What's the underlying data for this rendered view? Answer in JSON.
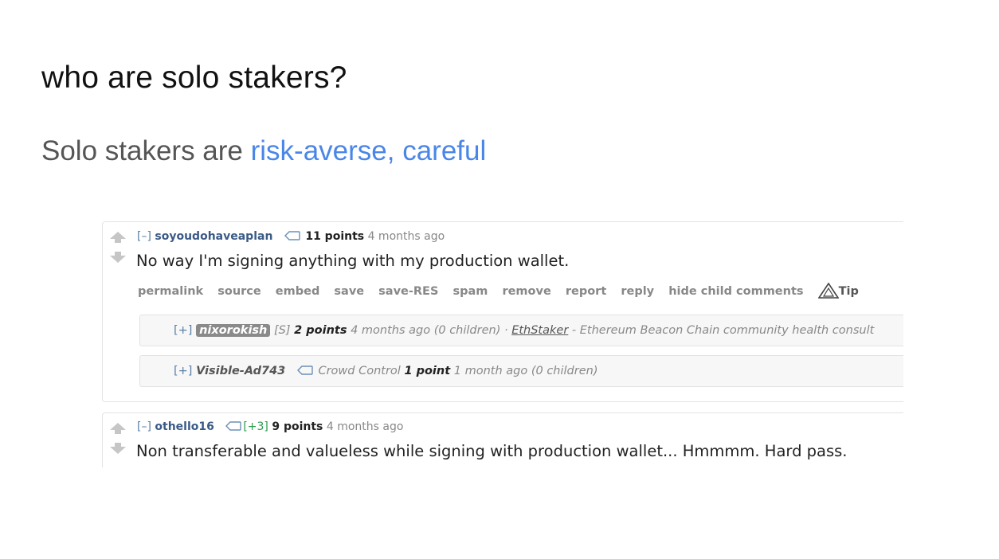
{
  "slide": {
    "title": "who are solo stakers?",
    "subtitle_lead": "Solo stakers are ",
    "subtitle_highlight": "risk-averse, careful",
    "highlight_color": "#4a86e8"
  },
  "comments": [
    {
      "collapse": "[–]",
      "author": "soyoudohaveaplan",
      "score": "11 points",
      "time": "4 months ago",
      "body": "No way I'm signing anything with my production wallet.",
      "buttons": [
        "permalink",
        "source",
        "embed",
        "save",
        "save-RES",
        "spam",
        "remove",
        "report",
        "reply",
        "hide child comments"
      ],
      "tip_label": "Tip",
      "children": [
        {
          "expand": "[+]",
          "author": "nixorokish",
          "role": "[S]",
          "score": "2 points",
          "meta": "4 months ago (0 children) · ",
          "flair_link": "EthStaker",
          "flair_text": " - Ethereum Beacon Chain community health consult"
        },
        {
          "expand": "[+]",
          "author": "Visible-Ad743",
          "flair": "Crowd Control",
          "score": "1 point",
          "meta": "1 month ago (0 children)"
        }
      ]
    },
    {
      "collapse": "[–]",
      "author": "othello16",
      "badge": "[+3]",
      "score": "9 points",
      "time": "4 months ago",
      "body": "Non transferable and valueless while signing with production wallet... Hmmmm. Hard pass."
    }
  ],
  "icons": {
    "upvote": "upvote-arrow-icon",
    "downvote": "downvote-arrow-icon",
    "tag": "tag-icon",
    "tip": "tip-triangle-icon"
  }
}
